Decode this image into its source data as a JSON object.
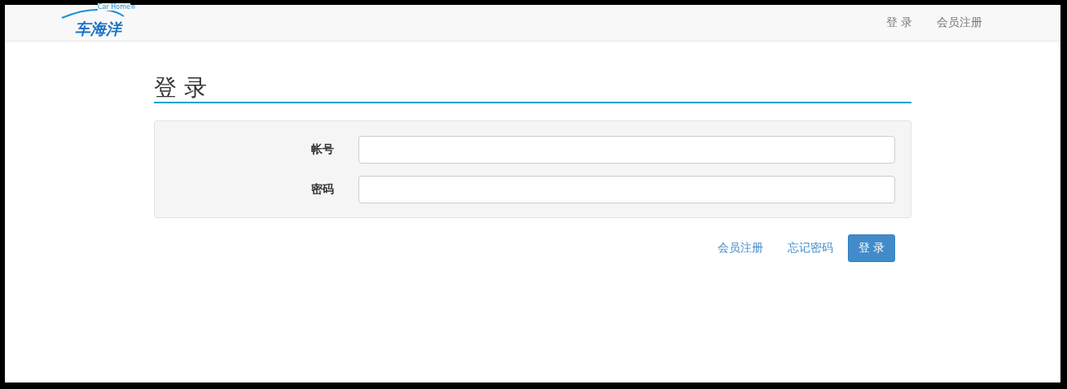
{
  "navbar": {
    "logo": {
      "name": "车海洋",
      "tagline": "Car Home",
      "mark": "®"
    },
    "links": [
      {
        "label": "登 录"
      },
      {
        "label": "会员注册"
      }
    ]
  },
  "heading": "登 录",
  "form": {
    "fields": [
      {
        "label": "帐号"
      },
      {
        "label": "密码"
      }
    ]
  },
  "actions": {
    "links": [
      {
        "label": "会员注册"
      },
      {
        "label": "忘记密码"
      }
    ],
    "submit": "登 录"
  }
}
